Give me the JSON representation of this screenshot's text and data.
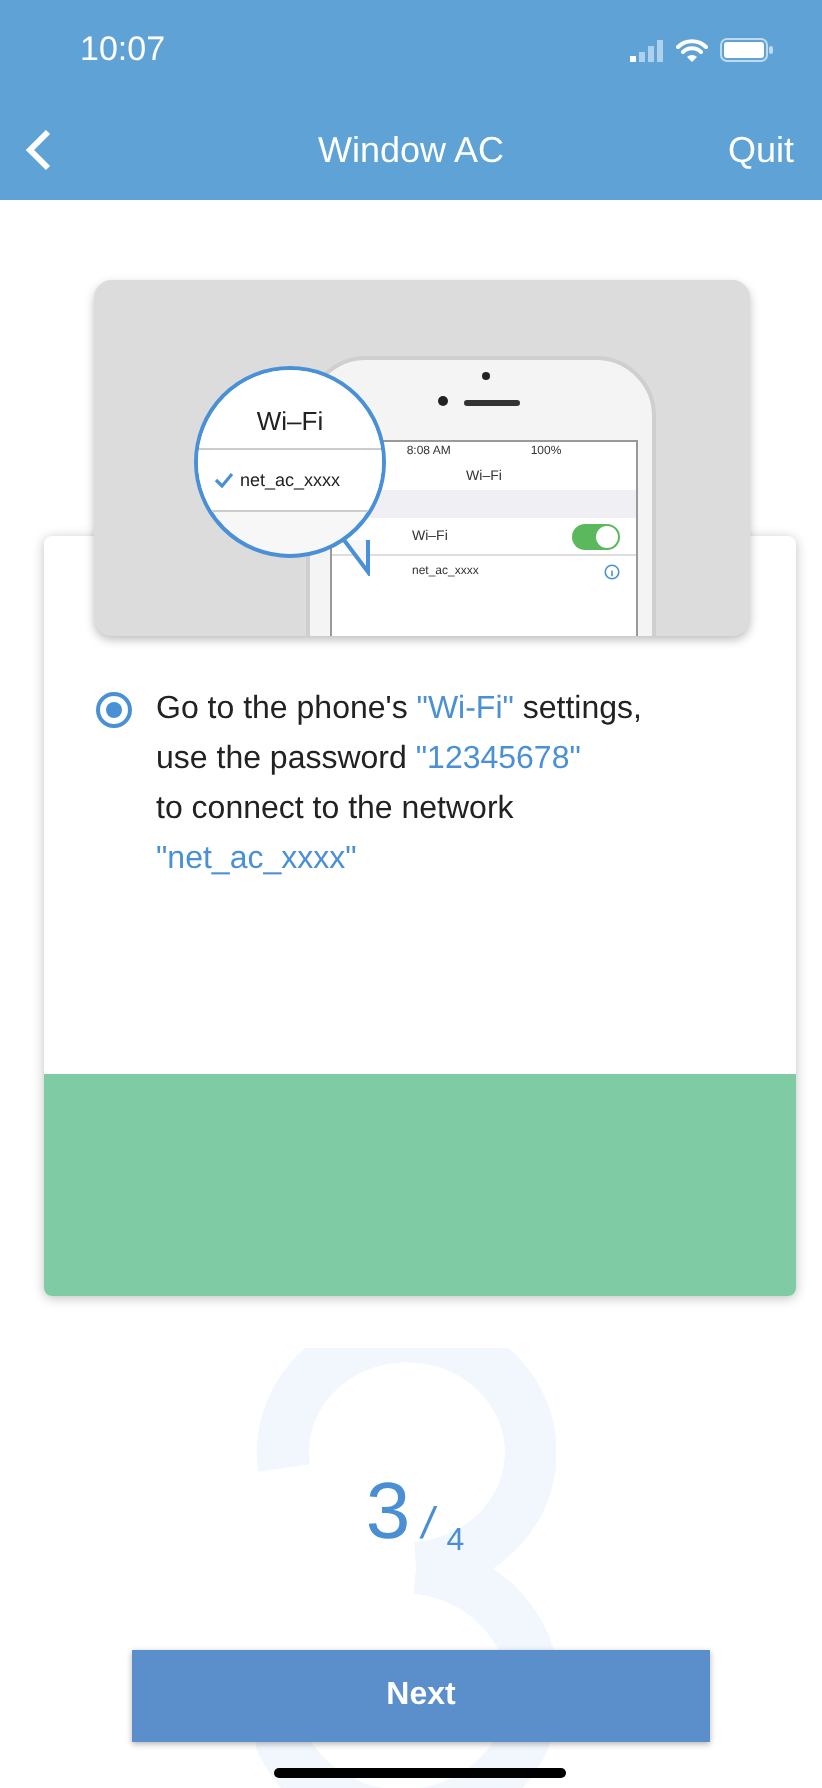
{
  "status_bar": {
    "time": "10:07"
  },
  "nav_bar": {
    "title": "Window AC",
    "action": "Quit"
  },
  "illustration": {
    "magnifier_title": "Wi–Fi",
    "magnifier_network": "net_ac_xxxx",
    "phone_time": "8:08 AM",
    "phone_battery": "100%",
    "phone_title": "Wi–Fi",
    "phone_wifi_label": "Wi–Fi",
    "phone_wifi_on": true,
    "phone_network": "net_ac_xxxx"
  },
  "instruction": {
    "selected": true,
    "lines": [
      [
        {
          "text": "Go to the phone's ",
          "highlighted": false
        },
        {
          "text": "\"Wi-Fi\"",
          "highlighted": true
        },
        {
          "text": " settings,",
          "highlighted": false
        }
      ],
      [
        {
          "text": "use the password ",
          "highlighted": false
        },
        {
          "text": "\"12345678\"",
          "highlighted": true
        }
      ],
      [
        {
          "text": "to connect to the network",
          "highlighted": false
        }
      ],
      [
        {
          "text": "\"net_ac_xxxx\"",
          "highlighted": true
        }
      ]
    ]
  },
  "step": {
    "current": "3",
    "separator": "/",
    "total": "4"
  },
  "next_button": {
    "label": "Next"
  }
}
